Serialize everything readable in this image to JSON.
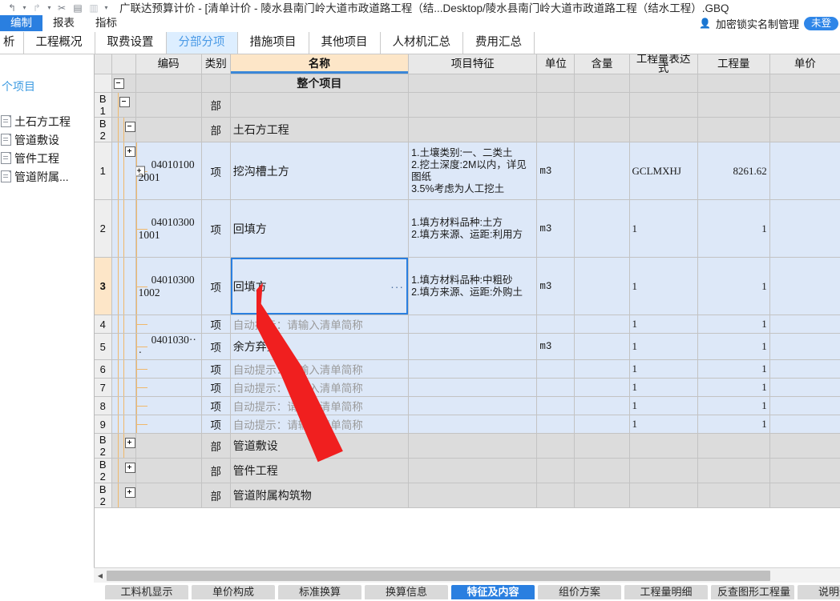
{
  "titlebar": {
    "title": "广联达预算计价 - [清单计价 - 陵水县南门岭大道市政道路工程（结...Desktop/陵水县南门岭大道市政道路工程（结水工程）.GBQ",
    "quick_access": [
      {
        "name": "undo-icon",
        "glyph": "↰"
      },
      {
        "name": "undo-dropdown-caret",
        "glyph": "▾"
      },
      {
        "name": "redo-icon",
        "glyph": "↱"
      },
      {
        "name": "redo-dropdown-caret",
        "glyph": "▾"
      },
      {
        "name": "cut-icon",
        "glyph": "✄"
      },
      {
        "name": "document-icon",
        "glyph": "▤"
      },
      {
        "name": "copy-icon",
        "glyph": "▥"
      },
      {
        "name": "more-caret",
        "glyph": "▾"
      }
    ]
  },
  "ribbon": {
    "tabs": [
      {
        "label": "编制",
        "active": true
      },
      {
        "label": "报表",
        "active": false
      },
      {
        "label": "指标",
        "active": false
      }
    ],
    "lock_icon": "person-lock-icon",
    "lock_label": "加密锁实名制管理",
    "login_pill": "未登"
  },
  "modules": {
    "tabs": [
      {
        "label": "析",
        "active": false,
        "first": true
      },
      {
        "label": "工程概况",
        "active": false
      },
      {
        "label": "取费设置",
        "active": false
      },
      {
        "label": "分部分项",
        "active": true
      },
      {
        "label": "措施项目",
        "active": false
      },
      {
        "label": "其他项目",
        "active": false
      },
      {
        "label": "人材机汇总",
        "active": false
      },
      {
        "label": "费用汇总",
        "active": false
      }
    ]
  },
  "tree": {
    "root": "个项目",
    "items": [
      {
        "label": "土石方工程",
        "icon": "document-icon"
      },
      {
        "label": "管道敷设",
        "icon": "document-icon"
      },
      {
        "label": "管件工程",
        "icon": "document-icon"
      },
      {
        "label": "管道附属...",
        "icon": "document-icon"
      }
    ]
  },
  "grid": {
    "headers": {
      "index": "",
      "tree": "",
      "code": "编码",
      "category": "类别",
      "name": "名称",
      "feature": "项目特征",
      "unit": "单位",
      "content": "含量",
      "expression": "工程量表达式",
      "quantity": "工程量",
      "price": "单价"
    },
    "name_header_accent": "#fde6c8",
    "name_header_underline": "#3a87d8",
    "rows": [
      {
        "idx": "",
        "type": "root",
        "code": "",
        "cat": "",
        "name": "整个项目",
        "feat": "",
        "unit": "",
        "content": "",
        "expr": "",
        "qty": "",
        "price": "",
        "expander": "minus"
      },
      {
        "idx": "B1",
        "type": "group",
        "code": "",
        "cat": "部",
        "name": "",
        "feat": "",
        "unit": "",
        "content": "",
        "expr": "",
        "qty": "",
        "price": "",
        "expander": "minus"
      },
      {
        "idx": "B2",
        "type": "group",
        "code": "",
        "cat": "部",
        "name": "土石方工程",
        "feat": "",
        "unit": "",
        "content": "",
        "expr": "",
        "qty": "",
        "price": "",
        "expander": "minus"
      },
      {
        "idx": "1",
        "type": "item",
        "code": "040101002001",
        "cat": "项",
        "name": "挖沟槽土方",
        "feat": "1.土壤类别:一、二类土\n2.挖土深度:2M以内，详见图纸\n3.5%考虑为人工挖土",
        "unit": "m3",
        "content": "",
        "expr": "GCLMXHJ",
        "qty": "8261.62",
        "price": "",
        "expander": "plus",
        "tall": true
      },
      {
        "idx": "2",
        "type": "item",
        "code": "040103001001",
        "cat": "项",
        "name": "回填方",
        "feat": "1.填方材料品种:土方\n2.填方来源、运距:利用方",
        "unit": "m3",
        "content": "",
        "expr": "1",
        "qty": "1",
        "price": "",
        "expander": "",
        "tall": true
      },
      {
        "idx": "3",
        "type": "item",
        "code": "040103001002",
        "cat": "项",
        "name": "回填方",
        "feat": "1.填方材料品种:中粗砂\n2.填方来源、运距:外购土",
        "unit": "m3",
        "content": "",
        "expr": "1",
        "qty": "1",
        "price": "",
        "expander": "",
        "tall": true,
        "selected": true,
        "cell_ellipsis": "···"
      },
      {
        "idx": "4",
        "type": "item",
        "code": "",
        "cat": "项",
        "name": "自动提示：请输入清单简称",
        "is_hint": true,
        "feat": "",
        "unit": "",
        "content": "",
        "expr": "1",
        "qty": "1",
        "price": ""
      },
      {
        "idx": "5",
        "type": "item",
        "code": "0401030···",
        "cat": "项",
        "name": "余方弃置",
        "feat": "",
        "unit": "m3",
        "content": "",
        "expr": "1",
        "qty": "1",
        "price": ""
      },
      {
        "idx": "6",
        "type": "item",
        "code": "",
        "cat": "项",
        "name": "自动提示：请输入清单简称",
        "is_hint": true,
        "feat": "",
        "unit": "",
        "content": "",
        "expr": "1",
        "qty": "1",
        "price": ""
      },
      {
        "idx": "7",
        "type": "item",
        "code": "",
        "cat": "项",
        "name": "自动提示：请输入清单简称",
        "is_hint": true,
        "feat": "",
        "unit": "",
        "content": "",
        "expr": "1",
        "qty": "1",
        "price": ""
      },
      {
        "idx": "8",
        "type": "item",
        "code": "",
        "cat": "项",
        "name": "自动提示：请输入清单简称",
        "is_hint": true,
        "feat": "",
        "unit": "",
        "content": "",
        "expr": "1",
        "qty": "1",
        "price": ""
      },
      {
        "idx": "9",
        "type": "item",
        "code": "",
        "cat": "项",
        "name": "自动提示：请输入清单简称",
        "is_hint": true,
        "feat": "",
        "unit": "",
        "content": "",
        "expr": "1",
        "qty": "1",
        "price": ""
      },
      {
        "idx": "B2",
        "type": "group",
        "code": "",
        "cat": "部",
        "name": "管道敷设",
        "feat": "",
        "unit": "",
        "content": "",
        "expr": "",
        "qty": "",
        "price": "",
        "expander": "plus"
      },
      {
        "idx": "B2",
        "type": "group",
        "code": "",
        "cat": "部",
        "name": "管件工程",
        "feat": "",
        "unit": "",
        "content": "",
        "expr": "",
        "qty": "",
        "price": "",
        "expander": "plus"
      },
      {
        "idx": "B2",
        "type": "group",
        "code": "",
        "cat": "部",
        "name": "管道附属构筑物",
        "feat": "",
        "unit": "",
        "content": "",
        "expr": "",
        "qty": "",
        "price": "",
        "expander": "plus"
      }
    ]
  },
  "bottom_tabs": [
    {
      "label": "工料机显示",
      "active": false
    },
    {
      "label": "单价构成",
      "active": false
    },
    {
      "label": "标准换算",
      "active": false
    },
    {
      "label": "换算信息",
      "active": false
    },
    {
      "label": "特征及内容",
      "active": true
    },
    {
      "label": "组价方案",
      "active": false
    },
    {
      "label": "工程量明细",
      "active": false
    },
    {
      "label": "反查图形工程量",
      "active": false
    },
    {
      "label": "说明信息",
      "active": false
    }
  ],
  "scrollbar": {
    "left_arrow": "◀"
  },
  "colors": {
    "accent_blue": "#2a7fe0",
    "tab_active_bg": "#ddeeff",
    "name_header": "#fde6c8",
    "row_item": "#dde8f8",
    "row_group": "#dcdcdc",
    "tree_line": "#f0b86b"
  }
}
